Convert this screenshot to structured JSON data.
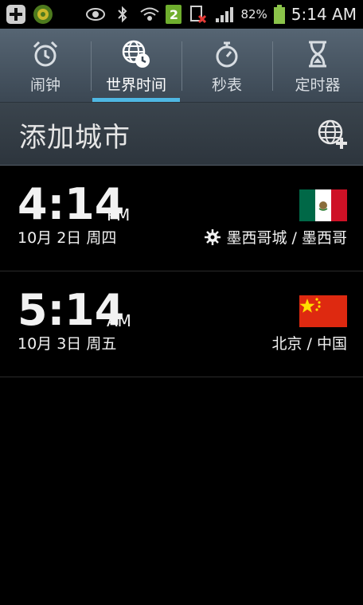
{
  "status_bar": {
    "sim_badge": "2",
    "battery_text": "82%",
    "time": "5:14 AM"
  },
  "tabs": [
    {
      "label": "闹钟",
      "icon": "alarm-clock-icon"
    },
    {
      "label": "世界时间",
      "icon": "world-clock-icon",
      "active": true
    },
    {
      "label": "秒表",
      "icon": "stopwatch-icon"
    },
    {
      "label": "定时器",
      "icon": "hourglass-icon"
    }
  ],
  "header": {
    "title": "添加城市",
    "add_icon": "add-globe-icon"
  },
  "clocks": [
    {
      "time": "4:14",
      "ampm": "PM",
      "date": "10月 2日 周四",
      "city": "墨西哥城 / 墨西哥",
      "flag": "mexico",
      "dst_icon": true
    },
    {
      "time": "5:14",
      "ampm": "AM",
      "date": "10月 3日 周五",
      "city": "北京 / 中国",
      "flag": "china",
      "dst_icon": false
    }
  ],
  "colors": {
    "accent": "#4fb7e3",
    "tab_bg": "#4a5661"
  }
}
